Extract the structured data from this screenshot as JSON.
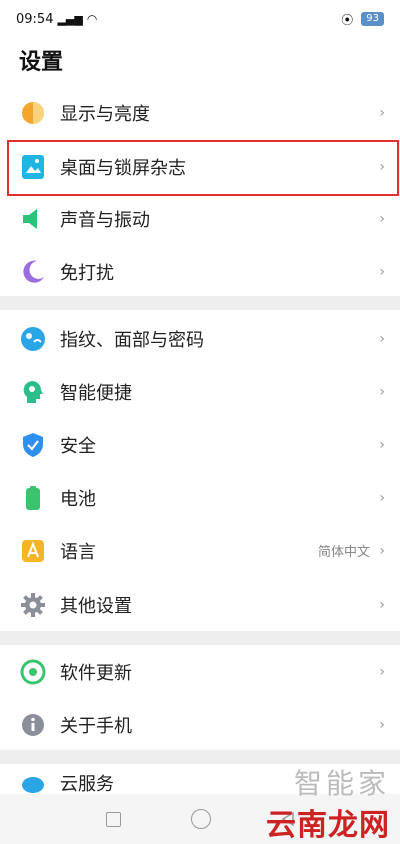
{
  "status_bar": {
    "time": "09:54",
    "battery": "93"
  },
  "page_title": "设置",
  "groups": [
    {
      "items": [
        {
          "label": "显示与亮度",
          "icon": "display-brightness-icon",
          "color": "#f4a52b"
        },
        {
          "label": "桌面与锁屏杂志",
          "icon": "wallpaper-icon",
          "color": "#1fb6e3",
          "highlighted": true
        },
        {
          "label": "声音与振动",
          "icon": "speaker-icon",
          "color": "#29c47a"
        },
        {
          "label": "免打扰",
          "icon": "moon-icon",
          "color": "#9b6ee0"
        }
      ]
    },
    {
      "items": [
        {
          "label": "指纹、面部与密码",
          "icon": "fingerprint-face-icon",
          "color": "#2aa6e6"
        },
        {
          "label": "智能便捷",
          "icon": "smart-head-icon",
          "color": "#2bbd8a"
        },
        {
          "label": "安全",
          "icon": "shield-icon",
          "color": "#2d8ff0"
        },
        {
          "label": "电池",
          "icon": "battery-icon",
          "color": "#3ac46e"
        },
        {
          "label": "语言",
          "icon": "language-icon",
          "color": "#f5b524",
          "value": "简体中文"
        },
        {
          "label": "其他设置",
          "icon": "gear-icon",
          "color": "#8a8f99"
        }
      ]
    },
    {
      "items": [
        {
          "label": "软件更新",
          "icon": "update-icon",
          "color": "#3ac46e"
        },
        {
          "label": "关于手机",
          "icon": "info-icon",
          "color": "#8a8f99"
        }
      ]
    },
    {
      "items": [
        {
          "label": "云服务",
          "icon": "cloud-icon",
          "color": "#2aa6e6"
        }
      ]
    }
  ],
  "chevron": "›",
  "watermark": {
    "top": "智能家",
    "bottom": "云南龙网"
  }
}
